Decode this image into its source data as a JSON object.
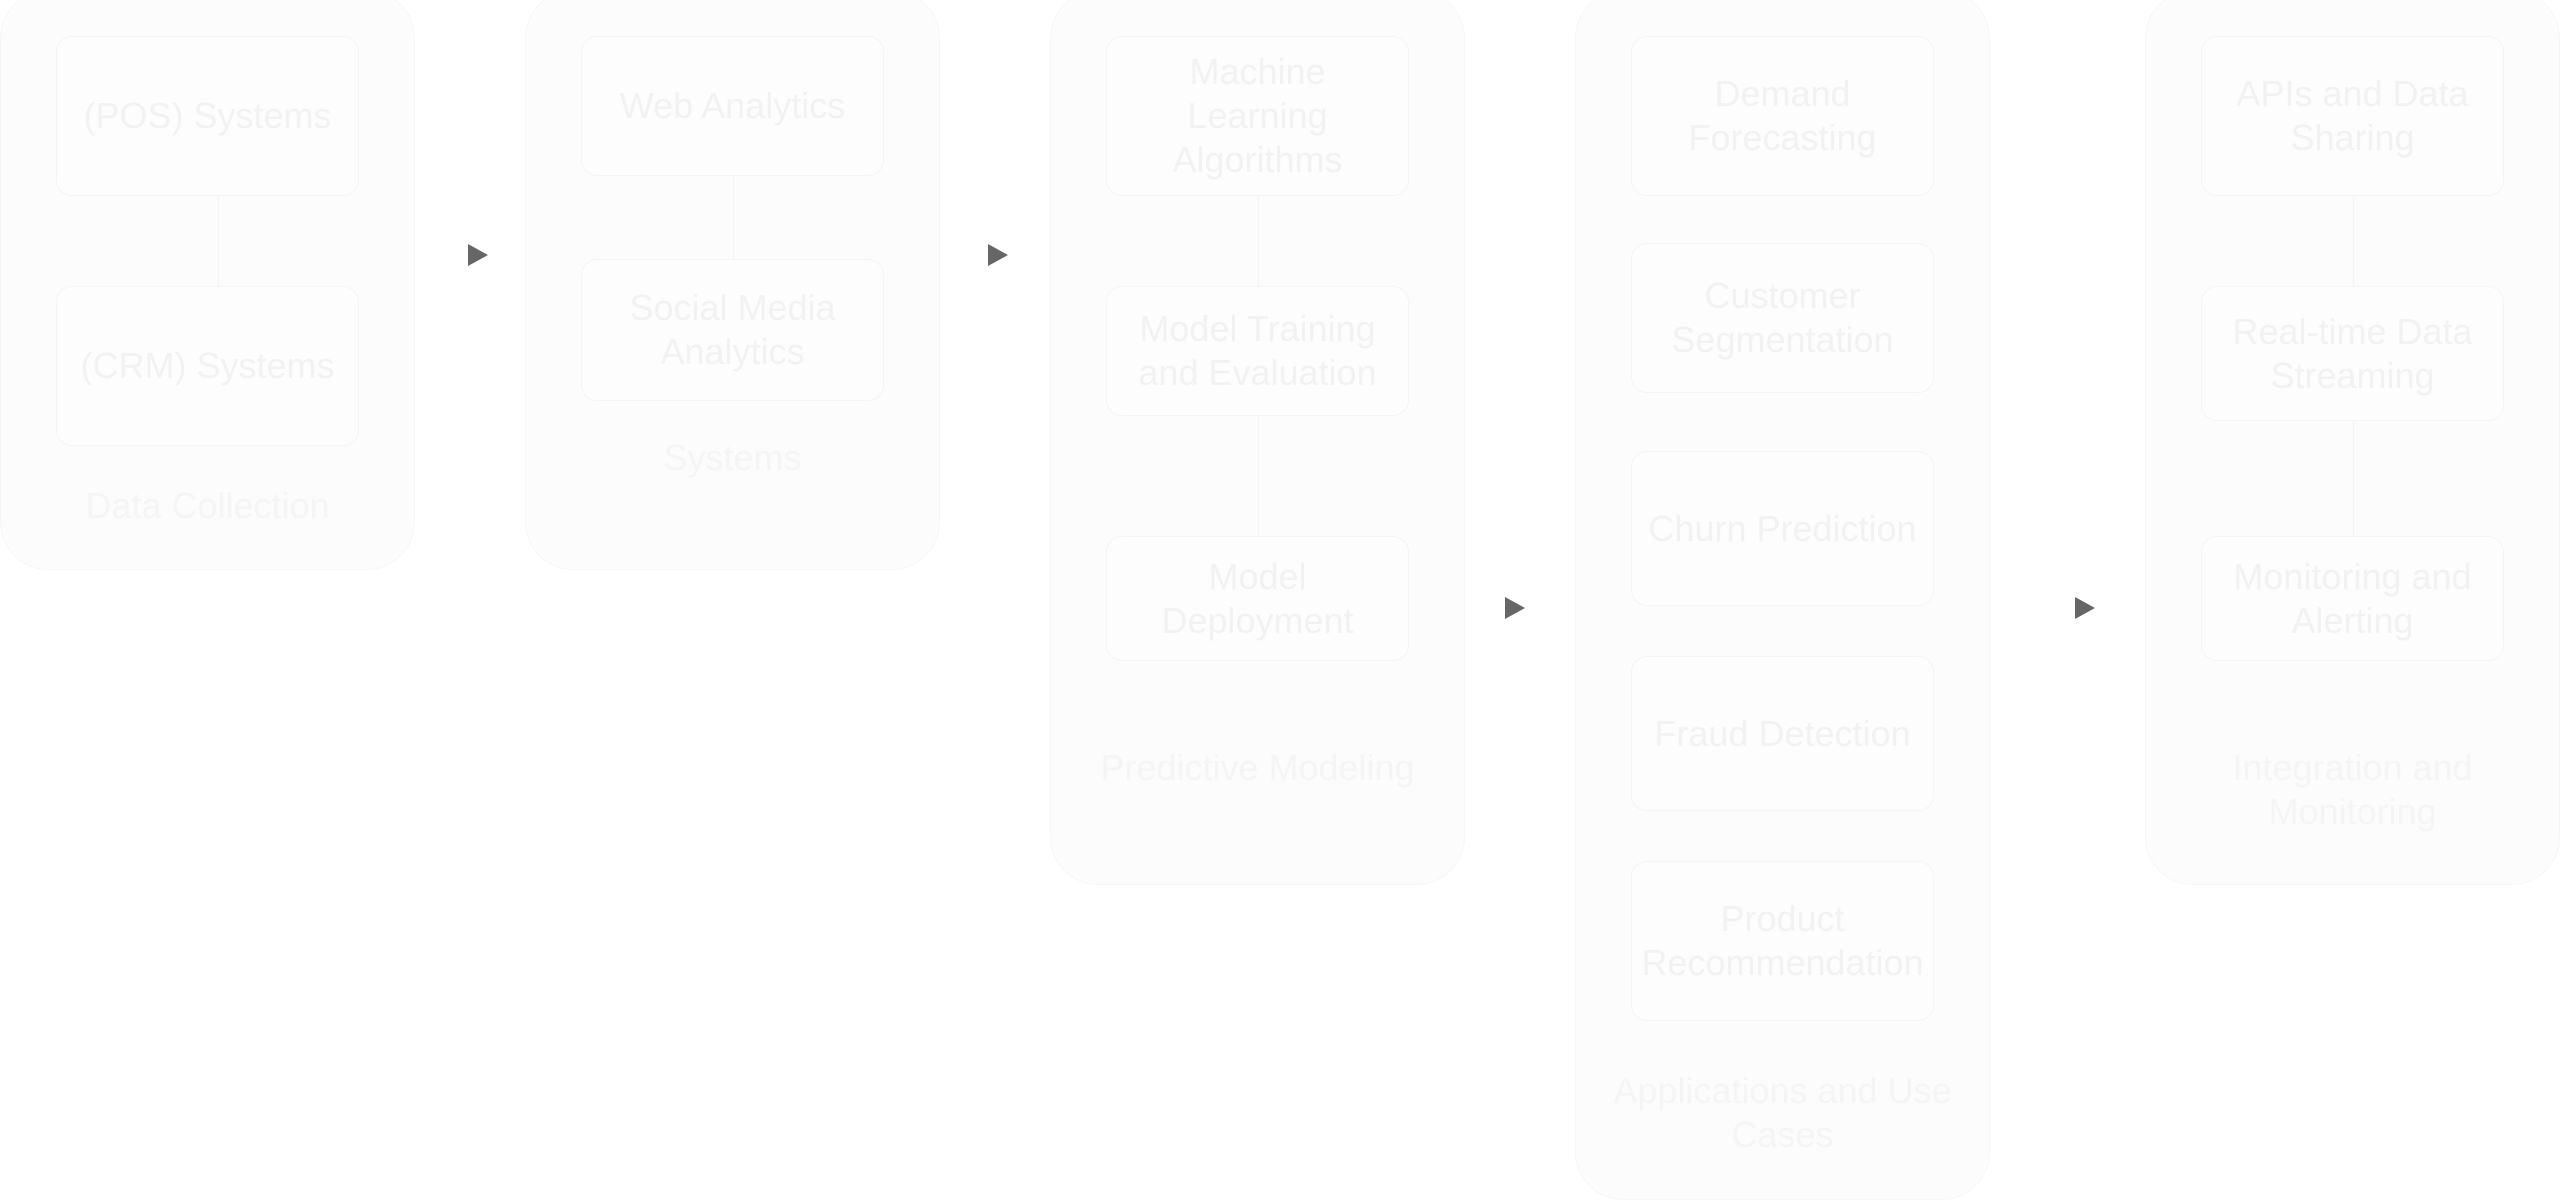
{
  "diagram": {
    "clusters": [
      {
        "label": "Data Collection",
        "nodes": [
          "(POS) Systems",
          "(CRM) Systems"
        ]
      },
      {
        "label": "Systems",
        "nodes": [
          "Web Analytics",
          "Social Media Analytics"
        ]
      },
      {
        "label": "Predictive Modeling",
        "nodes": [
          "Machine Learning Algorithms",
          "Model Training and Evaluation",
          "Model Deployment"
        ]
      },
      {
        "label": "Applications and Use Cases",
        "nodes": [
          "Demand Forecasting",
          "Customer Segmentation",
          "Churn Prediction",
          "Fraud Detection",
          "Product Recommendation"
        ]
      },
      {
        "label": "Integration and Monitoring",
        "nodes": [
          "APIs and Data Sharing",
          "Real-time Data Streaming",
          "Monitoring and Alerting"
        ]
      }
    ],
    "edges": [
      {
        "from": "Data Collection",
        "to": "Systems"
      },
      {
        "from": "Systems",
        "to": "Predictive Modeling"
      },
      {
        "from": "Predictive Modeling",
        "to": "Applications and Use Cases"
      },
      {
        "from": "Applications and Use Cases",
        "to": "Integration and Monitoring"
      }
    ],
    "colors": {
      "arrow": "#666666",
      "cluster_fill": "#fcfcfc",
      "text": "#f2f2f2"
    }
  }
}
